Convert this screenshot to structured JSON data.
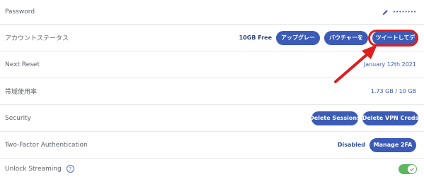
{
  "rows": {
    "password": {
      "label": "Password",
      "masked_value": "••••••••",
      "edit_icon": "pencil-icon"
    },
    "account_status": {
      "label": "アカウントステータス",
      "free_quota": "10GB Free",
      "upgrade_label": "アップグレー",
      "voucher_label": "バウチャーを",
      "tweet_label": "ツイートしてデ"
    },
    "next_reset": {
      "label": "Next Reset",
      "value": "January 12th 2021"
    },
    "bandwidth": {
      "label": "帯域使用率",
      "value": "1.73 GB / 10 GB"
    },
    "security": {
      "label": "Security",
      "delete_sessions_label": "Delete Sessions",
      "delete_vpn_label": "Delete VPN Creds"
    },
    "two_factor": {
      "label": "Two-Factor Authentication",
      "status": "Disabled",
      "manage_label": "Manage 2FA"
    },
    "unlock_streaming": {
      "label": "Unlock Streaming",
      "help_glyph": "?",
      "toggle_on": true
    }
  },
  "colors": {
    "button": "#3b5bb6",
    "annotation": "#e01d1d",
    "toggle": "#5ab75d"
  }
}
